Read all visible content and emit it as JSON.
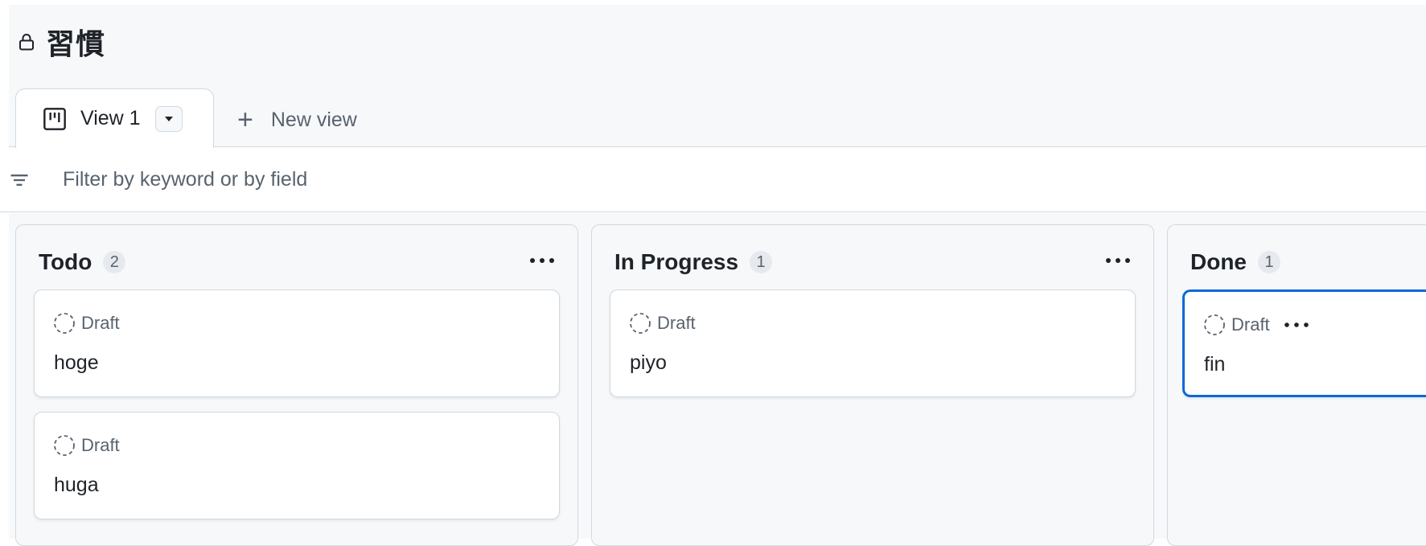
{
  "project": {
    "title": "習慣"
  },
  "views": {
    "tabs": [
      {
        "label": "View 1"
      }
    ],
    "new_view_label": "New view"
  },
  "filter": {
    "placeholder": "Filter by keyword or by field"
  },
  "columns": [
    {
      "name": "Todo",
      "count": "2",
      "cards": [
        {
          "status": "Draft",
          "title": "hoge"
        },
        {
          "status": "Draft",
          "title": "huga"
        }
      ]
    },
    {
      "name": "In Progress",
      "count": "1",
      "cards": [
        {
          "status": "Draft",
          "title": "piyo"
        }
      ]
    },
    {
      "name": "Done",
      "count": "1",
      "cards": [
        {
          "status": "Draft",
          "title": "fin",
          "selected": true
        }
      ]
    }
  ],
  "icons": {
    "lock": "lock-icon",
    "board_view": "project-board-icon",
    "caret": "caret-down-icon",
    "plus": "plus-icon",
    "filter": "filter-icon",
    "draft": "draft-issue-icon",
    "more": "kebab-horizontal-icon"
  },
  "colors": {
    "accent": "#0969da",
    "border": "#d1d9e0",
    "muted_text": "#59636e",
    "canvas": "#f6f8fa"
  }
}
